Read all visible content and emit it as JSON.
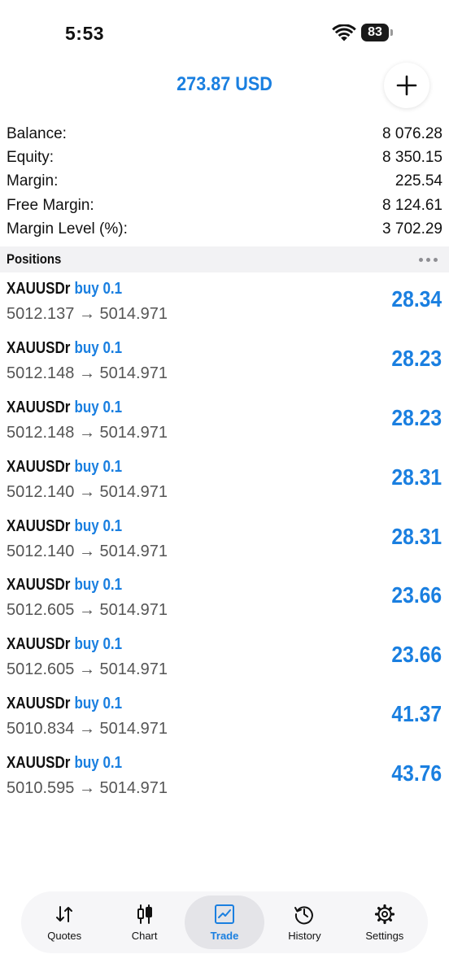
{
  "status_bar": {
    "time": "5:53",
    "battery": "83"
  },
  "header": {
    "profit_total": "273.87 USD",
    "add_icon": "plus-icon"
  },
  "summary": [
    {
      "label": "Balance:",
      "value": "8 076.28"
    },
    {
      "label": "Equity:",
      "value": "8 350.15"
    },
    {
      "label": "Margin:",
      "value": "225.54"
    },
    {
      "label": "Free Margin:",
      "value": "8 124.61"
    },
    {
      "label": "Margin Level (%):",
      "value": "3 702.29"
    }
  ],
  "positions": {
    "title": "Positions",
    "items": [
      {
        "symbol": "XAUUSDr",
        "side": "buy 0.1",
        "prices": "5012.137 → 5014.971",
        "profit": "28.34"
      },
      {
        "symbol": "XAUUSDr",
        "side": "buy 0.1",
        "prices": "5012.148 → 5014.971",
        "profit": "28.23"
      },
      {
        "symbol": "XAUUSDr",
        "side": "buy 0.1",
        "prices": "5012.148 → 5014.971",
        "profit": "28.23"
      },
      {
        "symbol": "XAUUSDr",
        "side": "buy 0.1",
        "prices": "5012.140 → 5014.971",
        "profit": "28.31"
      },
      {
        "symbol": "XAUUSDr",
        "side": "buy 0.1",
        "prices": "5012.140 → 5014.971",
        "profit": "28.31"
      },
      {
        "symbol": "XAUUSDr",
        "side": "buy 0.1",
        "prices": "5012.605 → 5014.971",
        "profit": "23.66"
      },
      {
        "symbol": "XAUUSDr",
        "side": "buy 0.1",
        "prices": "5012.605 → 5014.971",
        "profit": "23.66"
      },
      {
        "symbol": "XAUUSDr",
        "side": "buy 0.1",
        "prices": "5010.834 → 5014.971",
        "profit": "41.37"
      },
      {
        "symbol": "XAUUSDr",
        "side": "buy 0.1",
        "prices": "5010.595 → 5014.971",
        "profit": "43.76"
      }
    ]
  },
  "tabs": [
    {
      "label": "Quotes",
      "icon": "quotes-arrows-icon",
      "active": false
    },
    {
      "label": "Chart",
      "icon": "candlestick-icon",
      "active": false
    },
    {
      "label": "Trade",
      "icon": "trade-chart-icon",
      "active": true
    },
    {
      "label": "History",
      "icon": "history-clock-icon",
      "active": false
    },
    {
      "label": "Settings",
      "icon": "gear-icon",
      "active": false
    }
  ],
  "colors": {
    "accent": "#1a7fe0",
    "text": "#111111",
    "secondary": "#555555",
    "section_bg": "#f2f2f4"
  }
}
